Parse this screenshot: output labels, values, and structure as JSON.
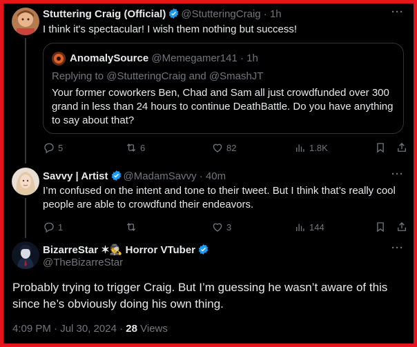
{
  "colors": {
    "border_accent": "#e8141b",
    "background": "#000000",
    "text_primary": "#e7e9ea",
    "text_secondary": "#71767b",
    "verified_blue": "#1d9bf0"
  },
  "tweet1": {
    "name": "Stuttering Craig (Official)",
    "handle": "@StutteringCraig",
    "sep": "·",
    "time": "1h",
    "text": "I think it's spectacular! I wish them nothing but success!",
    "more": "···",
    "quote": {
      "name": "AnomalySource",
      "handle": "@Memegamer141",
      "sep": "·",
      "time": "1h",
      "replying_prefix": "Replying to",
      "replying_user1": "@StutteringCraig",
      "replying_and": "and",
      "replying_user2": "@SmashJT",
      "text": "Your former coworkers Ben, Chad and Sam all just crowdfunded over 300 grand in less than 24 hours to continue DeathBattle. Do you have anything to say about that?"
    },
    "actions": {
      "replies": "5",
      "reposts": "6",
      "likes": "82",
      "views": "1.8K"
    }
  },
  "tweet2": {
    "name": "Savvy | Artist",
    "handle": "@MadamSavvy",
    "sep": "·",
    "time": "40m",
    "text": "I’m confused on the intent and tone to their tweet. But I think that’s really cool people are able to crowdfund their endeavors.",
    "more": "···",
    "actions": {
      "replies": "1",
      "reposts": "",
      "likes": "3",
      "views": "144"
    }
  },
  "tweet3": {
    "name": "BizarreStar ✶🕵 Horror VTuber",
    "handle": "@TheBizarreStar",
    "text": "Probably trying to trigger Craig. But I’m guessing he wasn’t aware of this since he’s obviously doing his own thing.",
    "timestamp": "4:09 PM · Jul 30, 2024 · ",
    "views_count": "28",
    "views_label": "Views"
  }
}
